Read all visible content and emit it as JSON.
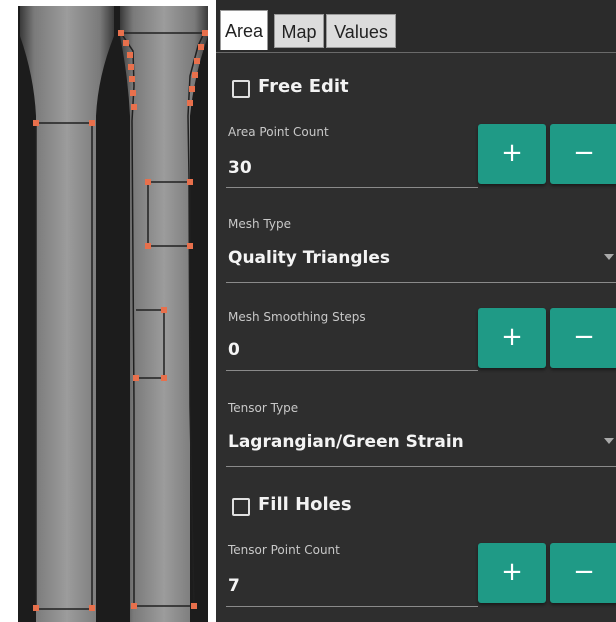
{
  "tabs": [
    {
      "label": "Area",
      "active": true
    },
    {
      "label": "Map",
      "active": false
    },
    {
      "label": "Values",
      "active": false
    }
  ],
  "free_edit": {
    "label": "Free Edit",
    "checked": false
  },
  "area_point_count": {
    "label": "Area Point Count",
    "value": "30",
    "plus": "+",
    "minus": "−"
  },
  "mesh_type": {
    "label": "Mesh Type",
    "value": "Quality Triangles"
  },
  "mesh_smoothing_steps": {
    "label": "Mesh Smoothing Steps",
    "value": "0",
    "plus": "+",
    "minus": "−"
  },
  "tensor_type": {
    "label": "Tensor Type",
    "value": "Lagrangian/Green Strain"
  },
  "fill_holes": {
    "label": "Fill Holes",
    "checked": false
  },
  "tensor_point_count": {
    "label": "Tensor Point Count",
    "value": "7",
    "plus": "+",
    "minus": "−"
  },
  "colors": {
    "accent": "#1f9a86",
    "panel": "#2e2e2e",
    "marker": "#e8704c"
  }
}
